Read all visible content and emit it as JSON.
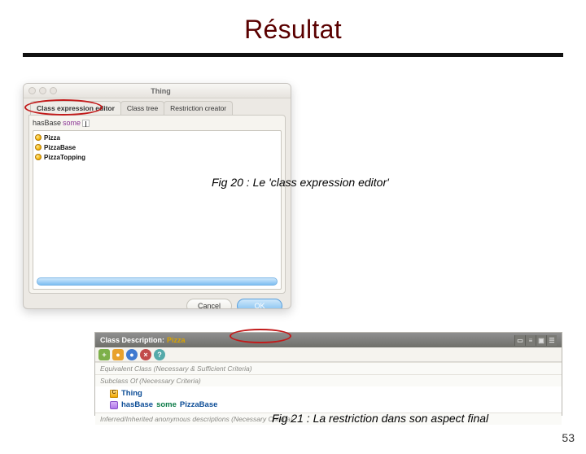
{
  "slide": {
    "title": "Résultat",
    "page_number": "53"
  },
  "captions": {
    "fig20": "Fig 20 : Le 'class expression editor'",
    "fig21": "Fig 21 : La restriction dans son aspect final"
  },
  "dialog": {
    "window_title": "Thing",
    "tabs": {
      "editor": "Class expression editor",
      "tree": "Class tree",
      "restriction": "Restriction creator"
    },
    "expression": {
      "prefix": "hasBase",
      "keyword": "some"
    },
    "list": [
      "Pizza",
      "PizzaBase",
      "PizzaTopping"
    ],
    "buttons": {
      "cancel": "Cancel",
      "ok": "OK"
    }
  },
  "desc": {
    "header": {
      "label": "Class Description:",
      "subject": "Pizza"
    },
    "sections": {
      "equiv": "Equivalent Class (Necessary & Sufficient Criteria)",
      "sub": "Subclass Of (Necessary Criteria)",
      "inherited": "Inferred/Inherited anonymous descriptions (Necessary Criteria)"
    },
    "subclass": {
      "thing": "Thing",
      "has_base": "hasBase",
      "some": "some",
      "target": "PizzaBase"
    }
  }
}
